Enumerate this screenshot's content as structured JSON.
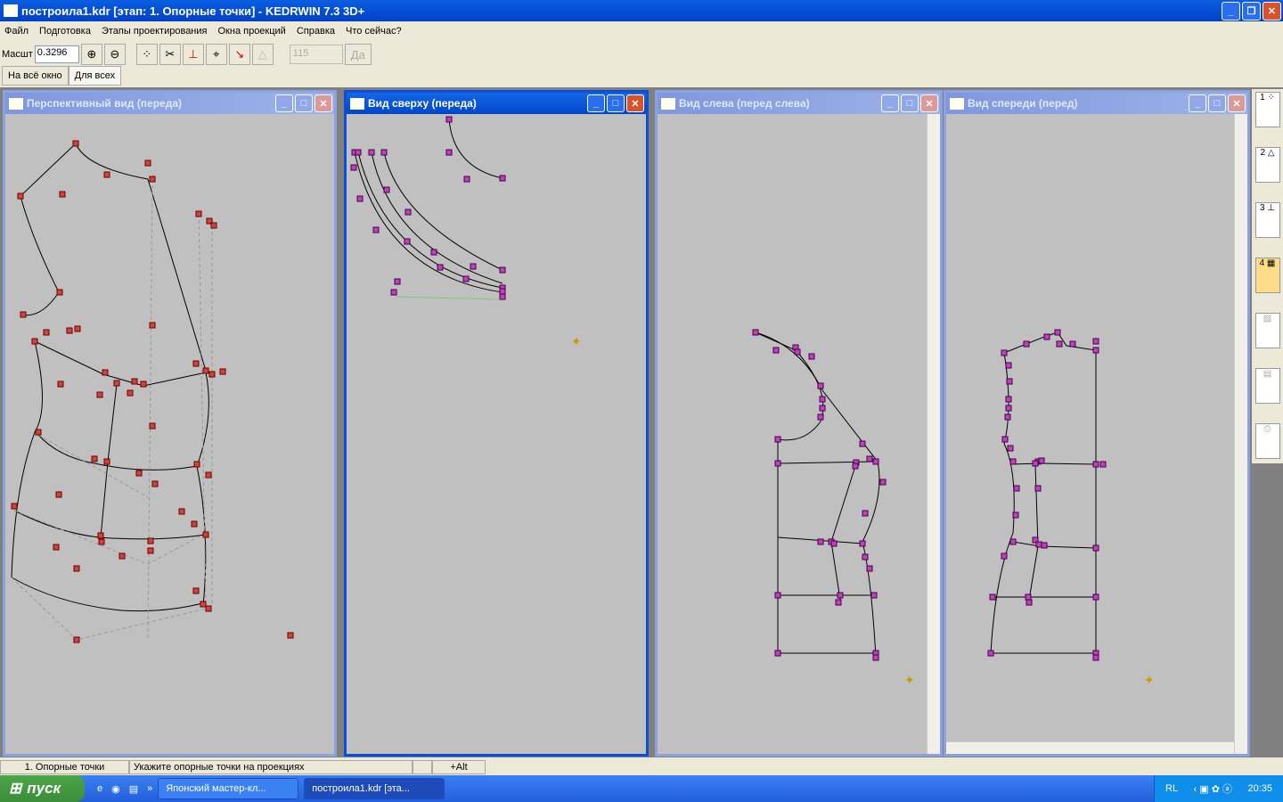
{
  "app": {
    "title": "построила1.kdr [этап: 1. Опорные точки] - KEDRWIN 7.3 3D+"
  },
  "menu": [
    "Файл",
    "Подготовка",
    "Этапы проектирования",
    "Окна проекций",
    "Справка",
    "Что сейчас?"
  ],
  "toolbar": {
    "scale_label": "Масшт",
    "scale_value": "0.3296",
    "num_value": "115",
    "yes_label": "Да"
  },
  "tabs": [
    "На всё окно",
    "Для всех"
  ],
  "windows": {
    "perspective": "Перспективный вид (переда)",
    "top": "Вид сверху (переда)",
    "left": "Вид слева (перед слева)",
    "front": "Вид спереди (перед)"
  },
  "status": {
    "stage": "1. Опорные точки",
    "hint": "Укажите опорные точки на проекциях",
    "modifier": "+Alt"
  },
  "taskbar": {
    "start": "пуск",
    "tasks": [
      "Японский мастер-кл...",
      "построила1.kdr [эта..."
    ],
    "lang": "RL",
    "clock": "20:35"
  },
  "colors": {
    "point_persp": "#c0392b",
    "point_views": "#c030c0",
    "active_title": "#0a4fd6"
  }
}
